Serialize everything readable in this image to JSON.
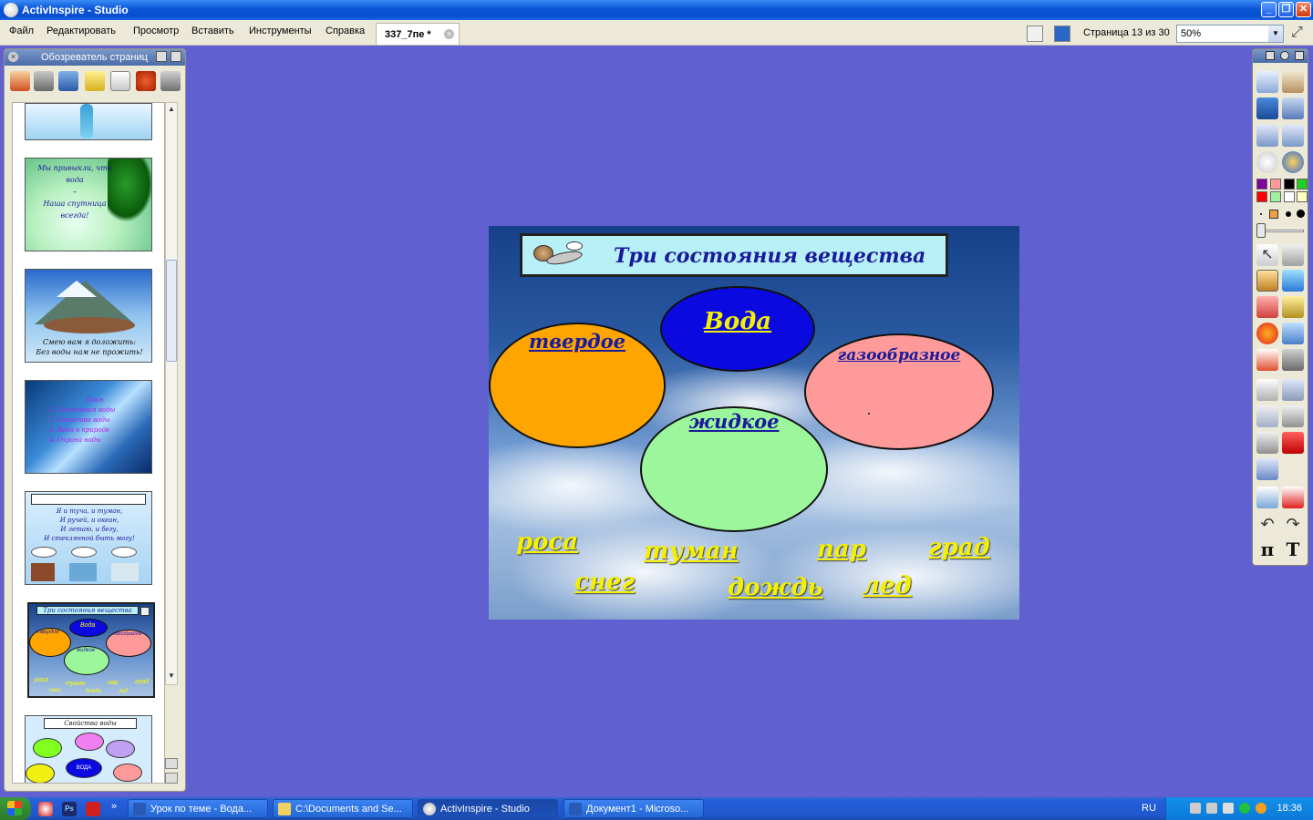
{
  "window": {
    "title": "ActivInspire - Studio",
    "buttons": [
      "_",
      "❐",
      "✕"
    ]
  },
  "menu": {
    "items": [
      "Файл",
      "Редактировать",
      "Просмотр",
      "Вставить",
      "Инструменты",
      "Справка"
    ]
  },
  "doc_tab": {
    "label": "337_7пе *"
  },
  "page_info": "Страница 13 из 30",
  "zoom": {
    "value": "50%"
  },
  "page_browser": {
    "title": "Обозреватель страниц"
  },
  "thumbnails": {
    "t2_lines": [
      "Мы привыкли, что вода",
      "–",
      "Наша спутница всегда!"
    ],
    "t3_lines": [
      "Смею вам я доложить:",
      "Без воды нам не прожить!"
    ],
    "t4_lines": [
      "План",
      "1. Состояния воды",
      "2. Свойства воды",
      "3. Вода в природе",
      "4. Охрана воды"
    ],
    "t5_lines": [
      "Я и туча, и туман,",
      "И ручей, и океан,",
      "И летаю, и бегу,",
      "И стеклянной быть могу!"
    ],
    "t6_title": "Три состояния вещества",
    "t6_labels": [
      "твердое",
      "Вода",
      "газообразное",
      "жидкое",
      "роса",
      "туман",
      "пар",
      "град",
      "снег",
      "дождь",
      "лед"
    ],
    "t7_title": "Свойства воды",
    "t7_center": "ВОДА"
  },
  "slide": {
    "title": "Три состояния вещества",
    "center": "Вода",
    "solid": "твердое",
    "gas": "газообразное",
    "liquid": "жидкое",
    "words": {
      "rosa": "роса",
      "tuman": "туман",
      "par": "пар",
      "grad": "град",
      "sneg": "снег",
      "dozhd": "дождь",
      "led": "лед"
    },
    "colors": {
      "solid": "#ffa500",
      "center": "#0a0ae0",
      "gas": "#ff9a9a",
      "liquid": "#9cf79c",
      "title_box": "#b8f0f8",
      "words": "#f4f000"
    }
  },
  "taskbar": {
    "tasks": [
      "Урок по теме - Вода...",
      "C:\\Documents and Se...",
      "ActivInspire - Studio",
      "Документ1 - Microso..."
    ],
    "lang": "RU",
    "clock": "18:36"
  },
  "desktop_color": "#6060d0"
}
